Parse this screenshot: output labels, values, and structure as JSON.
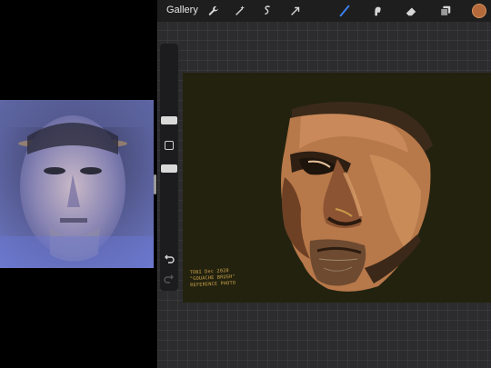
{
  "topbar": {
    "gallery_label": "Gallery",
    "tools_left": [
      "wrench-icon",
      "magic-wand-icon",
      "selection-icon",
      "transform-arrow-icon"
    ],
    "tools_right": [
      "brush-icon",
      "smudge-icon",
      "eraser-icon",
      "layers-icon"
    ],
    "current_color": "#b56a3c",
    "active_tool_color": "#3b82f6"
  },
  "sidebar": {
    "controls": [
      "brush-size-slider",
      "modify-button",
      "opacity-slider",
      "undo-icon",
      "redo-icon"
    ]
  },
  "canvas": {
    "background": "#23220f",
    "signature_lines": [
      "TOBI Dec 2020",
      "\"GOUACHE BRUSH\"",
      "REFERENCE PHOTO"
    ]
  },
  "reference": {
    "tint": "#6a74b0"
  }
}
